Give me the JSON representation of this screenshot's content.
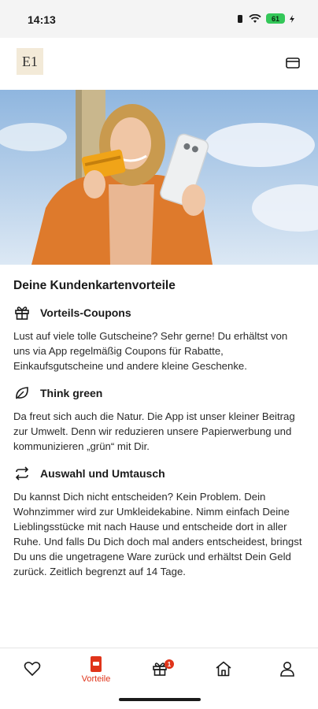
{
  "status_bar": {
    "time": "14:13",
    "battery": "61"
  },
  "header": {
    "logo_text": "E1",
    "card_icon": "card-icon"
  },
  "hero": {
    "image_description_icon": "hero-image"
  },
  "page_title": "Deine Kundenkartenvorteile",
  "sections": [
    {
      "icon": "gift-icon",
      "title": "Vorteils-Coupons",
      "text": "Lust auf viele tolle Gutscheine? Sehr gerne! Du erhältst von uns via App regelmäßig Coupons für Rabatte, Einkaufsgutscheine und andere kleine Geschenke."
    },
    {
      "icon": "leaf-icon",
      "title": "Think green",
      "text": "Da freut sich auch die Natur. Die App ist unser kleiner Beitrag zur Umwelt. Denn wir reduzieren unsere Papierwerbung und kommunizieren „grün“ mit Dir."
    },
    {
      "icon": "exchange-icon",
      "title": "Auswahl und Umtausch",
      "text": "Du kannst Dich nicht entscheiden? Kein Problem. Dein Wohnzimmer wird zur Umkleidekabine. Nimm einfach Deine Lieblingsstücke mit nach Hause und entscheide dort in aller Ruhe. Und falls Du Dich doch mal anders entscheidest, bringst Du uns die ungetragene Ware zurück und erhältst Dein Geld zurück. Zeitlich begrenzt auf 14 Tage."
    }
  ],
  "bottom_nav": {
    "items": [
      {
        "icon": "heart-icon",
        "label": ""
      },
      {
        "icon": "phone-card-icon",
        "label": "Vorteile",
        "active": true
      },
      {
        "icon": "gift-icon",
        "label": "",
        "badge": "1"
      },
      {
        "icon": "home-icon",
        "label": ""
      },
      {
        "icon": "user-icon",
        "label": ""
      }
    ]
  },
  "colors": {
    "accent": "#e0341a",
    "text": "#1a1a1a",
    "battery": "#34c759"
  }
}
